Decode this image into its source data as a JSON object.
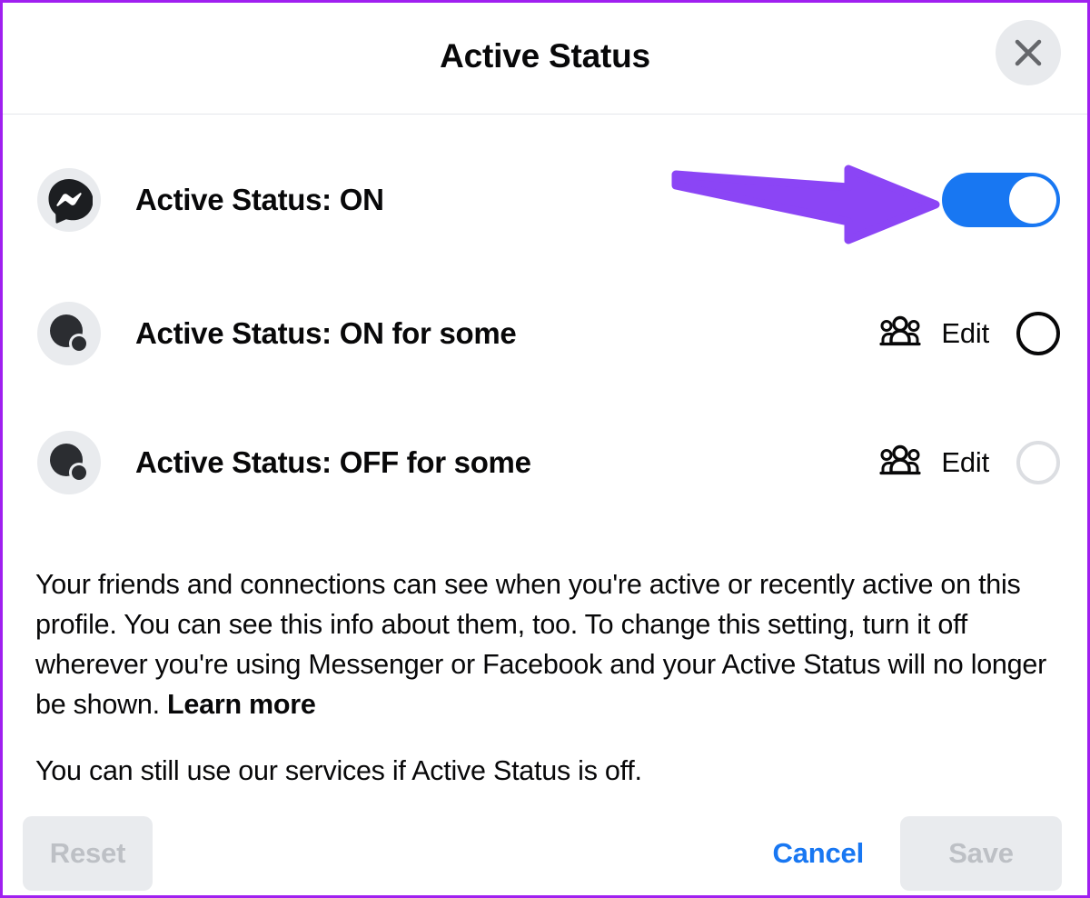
{
  "dialog": {
    "title": "Active Status",
    "close_icon": "close-icon"
  },
  "options": [
    {
      "icon": "messenger-logo-icon",
      "label": "Active Status: ON",
      "control": "toggle",
      "toggle_state": "on",
      "annotation": "purple-arrow-pointing-right"
    },
    {
      "icon": "active-status-some-icon",
      "label": "Active Status: ON for some",
      "people_icon": "people-group-icon",
      "edit_label": "Edit",
      "control": "radio",
      "selected": false,
      "enabled": true
    },
    {
      "icon": "active-status-some-icon",
      "label": "Active Status: OFF for some",
      "people_icon": "people-group-icon",
      "edit_label": "Edit",
      "control": "radio",
      "selected": false,
      "enabled": false
    }
  ],
  "description": {
    "paragraph1_text": "Your friends and connections can see when you're active or recently active on this profile. You can see this info about them, too. To change this setting, turn it off wherever you're using Messenger or Facebook and your Active Status will no longer be shown. ",
    "learn_more": "Learn more",
    "paragraph2": "You can still use our services if Active Status is off."
  },
  "footer": {
    "reset_label": "Reset",
    "cancel_label": "Cancel",
    "save_label": "Save"
  },
  "colors": {
    "accent_blue": "#1877f2",
    "annotation_purple": "#8b45f5",
    "frame_purple": "#a020f0",
    "disabled_text": "#bdc0c5",
    "surface_gray": "#e9ebee",
    "text_primary": "#080809"
  }
}
